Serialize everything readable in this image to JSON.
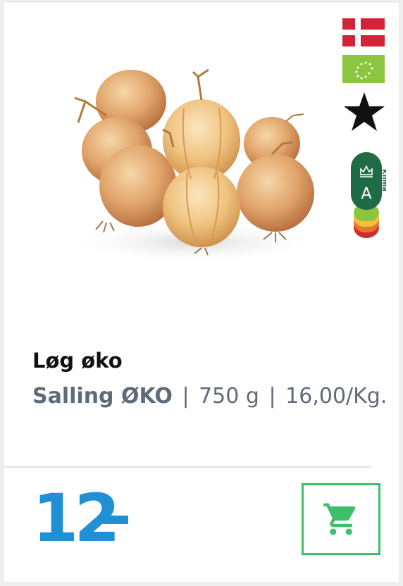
{
  "product": {
    "name": "Løg øko",
    "brand": "Salling ØKO",
    "separator": "|",
    "weight": "750 g",
    "unit_price": "16,00/Kg."
  },
  "price": {
    "amount": "12",
    "suffix": "-",
    "color": "#1f8fd6"
  },
  "badges": {
    "origin_flag": "denmark-flag-icon",
    "organic": "eu-organic-leaf-icon",
    "star": "black-star-icon",
    "climate": {
      "label": "Klima",
      "grade": "A",
      "grade_colors": [
        "#1f6b45",
        "#8cc640",
        "#f3c13a",
        "#e9732f",
        "#c9302c"
      ]
    }
  },
  "cart": {
    "icon": "shopping-cart-icon",
    "accent": "#3fbf6a"
  },
  "product_image": "onions-image"
}
